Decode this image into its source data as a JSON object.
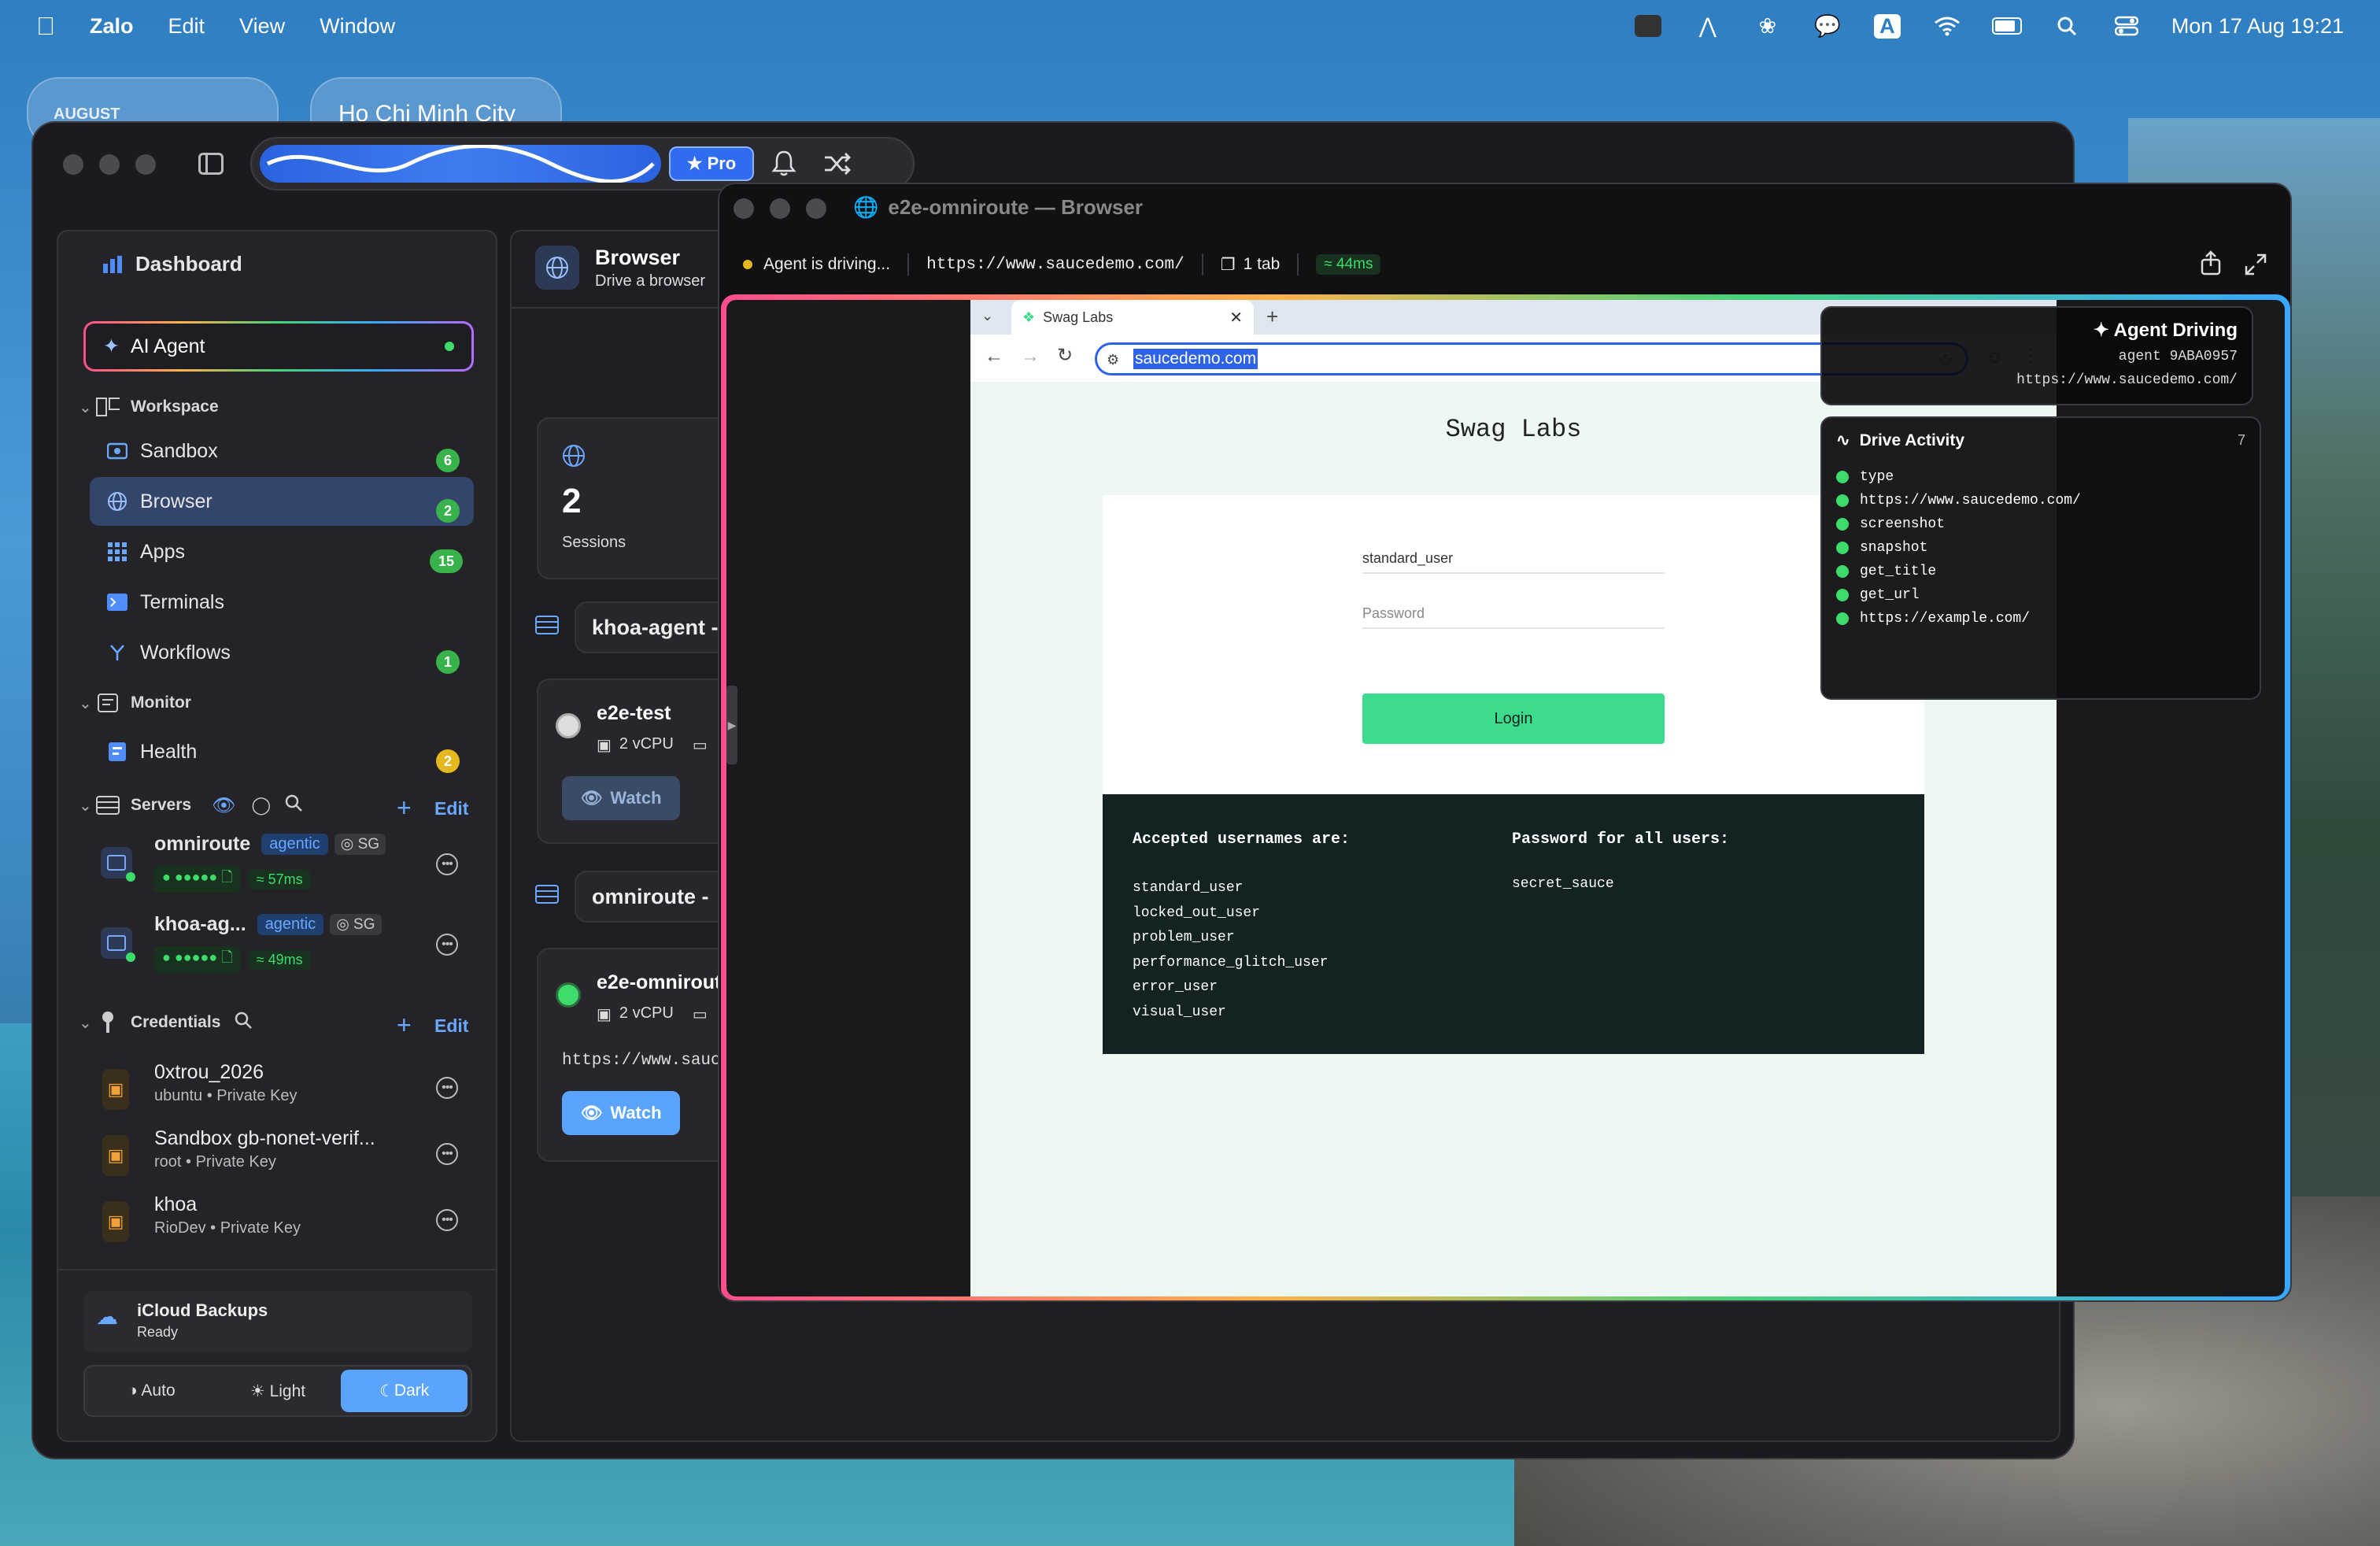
{
  "menubar": {
    "app": "Zalo",
    "items": [
      "Edit",
      "View",
      "Window"
    ],
    "clock": "Mon 17 Aug  19:21"
  },
  "widgets": {
    "calendar_label": "AUGUST",
    "weather_city": "Ho Chi Minh City"
  },
  "toolbar": {
    "pro_label": "★ Pro"
  },
  "sidebar": {
    "dashboard": "Dashboard",
    "ai_agent": "AI Agent",
    "workspace": "Workspace",
    "items": [
      {
        "label": "Sandbox",
        "badge": "6"
      },
      {
        "label": "Browser",
        "badge": "2"
      },
      {
        "label": "Apps",
        "badge": "15"
      },
      {
        "label": "Terminals",
        "badge": ""
      },
      {
        "label": "Workflows",
        "badge": "1"
      }
    ],
    "monitor": "Monitor",
    "health": {
      "label": "Health",
      "badge": "2"
    },
    "servers_header": "Servers",
    "edit": "Edit",
    "servers": [
      {
        "name": "omniroute",
        "tag": "agentic",
        "region": "SG",
        "latency": "57ms"
      },
      {
        "name": "khoa-ag...",
        "tag": "agentic",
        "region": "SG",
        "latency": "49ms"
      }
    ],
    "credentials_header": "Credentials",
    "credentials": [
      {
        "name": "0xtrou_2026",
        "sub": "ubuntu • Private Key"
      },
      {
        "name": "Sandbox gb-nonet-verif...",
        "sub": "root • Private Key"
      },
      {
        "name": "khoa",
        "sub": "RioDev • Private Key"
      }
    ],
    "icloud": {
      "title": "iCloud Backups",
      "status": "Ready"
    },
    "theme": {
      "auto": "Auto",
      "light": "Light",
      "dark": "Dark"
    }
  },
  "center": {
    "title": "Browser",
    "subtitle": "Drive a browser",
    "sessions_count": "2",
    "sessions_label": "Sessions",
    "groups": [
      {
        "name": "khoa-agent -",
        "session": "e2e-test",
        "cpu": "2 vCPU",
        "watch": "Watch",
        "url": ""
      },
      {
        "name": "omniroute -",
        "session": "e2e-omnirout",
        "cpu": "2 vCPU",
        "watch": "Watch",
        "url": "https://www.sauc"
      }
    ]
  },
  "browser": {
    "window_title": "e2e-omniroute — Browser",
    "status": "Agent is driving...",
    "url": "https://www.saucedemo.com/",
    "tabs": "1 tab",
    "latency": "44ms",
    "tab_title": "Swag Labs",
    "address": "saucedemo.com",
    "page": {
      "heading": "Swag Labs",
      "username_value": "standard_user",
      "password_placeholder": "Password",
      "login": "Login",
      "accepted_header": "Accepted usernames are:",
      "usernames": [
        "standard_user",
        "locked_out_user",
        "problem_user",
        "performance_glitch_user",
        "error_user",
        "visual_user"
      ],
      "password_header": "Password for all users:",
      "password_value": "secret_sauce"
    },
    "agent_panel": {
      "title": "Agent Driving",
      "agent_id": "agent 9ABA0957",
      "url": "https://www.saucedemo.com/"
    },
    "activity": {
      "title": "Drive Activity",
      "count": "7",
      "items": [
        "type",
        "https://www.saucedemo.com/",
        "screenshot",
        "snapshot",
        "get_title",
        "get_url",
        "https://example.com/"
      ]
    }
  },
  "colors": {
    "accent": "#3a8bff",
    "green": "#3ddc6a",
    "login_button": "#3ddc8c",
    "selected_item": "#34456b"
  }
}
